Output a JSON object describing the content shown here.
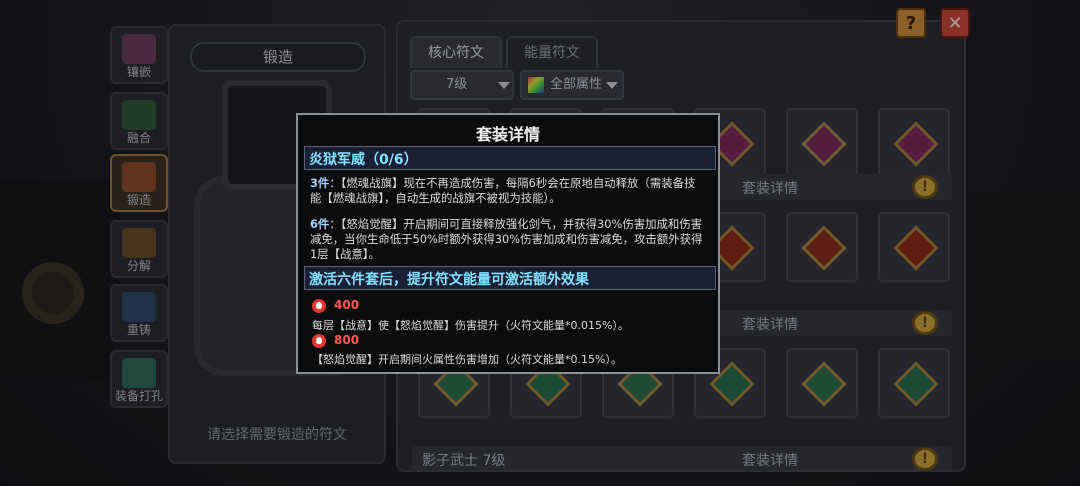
{
  "tools": [
    {
      "label": "镶嵌",
      "icon": "inlay-icon"
    },
    {
      "label": "融合",
      "icon": "fusion-icon"
    },
    {
      "label": "锻造",
      "icon": "forge-icon"
    },
    {
      "label": "分解",
      "icon": "decompose-icon"
    },
    {
      "label": "重铸",
      "icon": "recast-icon"
    },
    {
      "label": "装备打孔",
      "icon": "drill-icon"
    }
  ],
  "forge": {
    "title": "锻造",
    "hint": "请选择需要锻造的符文"
  },
  "runes": {
    "tabs": [
      "核心符文",
      "能量符文"
    ],
    "level_filter": "7级",
    "attr_filter": "全部属性",
    "set_details_label": "套装详情",
    "bottom_set_name": "影子武士 7级"
  },
  "buttons": {
    "help": "?",
    "close": "✕"
  },
  "popup": {
    "title": "套装详情",
    "set_name": "炎狱军威（0/6）",
    "bonus3_tag": "3件",
    "bonus3_text": "：【燃魂战旗】现在不再造成伤害，每隔6秒会在原地自动释放（需装备技能【燃魂战旗】，自动生成的战旗不被视为技能）。",
    "bonus6_tag": "6件",
    "bonus6_text": "：【怒焰觉醒】开启期间可直接释放强化剑气，并获得30%伤害加成和伤害减免，当你生命低于50%时额外获得30%伤害加成和伤害减免，攻击额外获得1层【战意】。",
    "extra_title": "激活六件套后，提升符文能量可激活额外效果",
    "extras": [
      {
        "energy": "400",
        "desc": "每层【战意】使【怒焰觉醒】伤害提升（火符文能量*0.015%）。"
      },
      {
        "energy": "800",
        "desc": "【怒焰觉醒】开启期间火属性伤害增加（火符文能量*0.15%）。"
      }
    ]
  }
}
